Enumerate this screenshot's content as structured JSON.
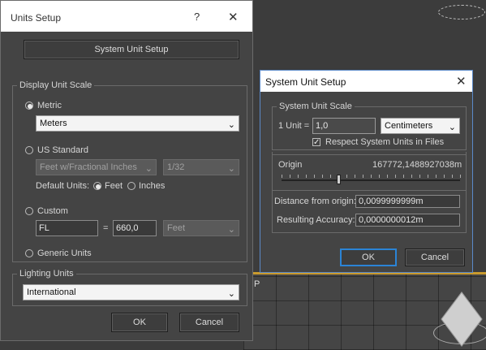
{
  "units_setup": {
    "title": "Units Setup",
    "help_label": "?",
    "close_glyph": "✕",
    "system_unit_setup_button": "System Unit Setup",
    "display_unit_scale": {
      "legend": "Display Unit Scale",
      "metric_label": "Metric",
      "metric_value": "Meters",
      "us_standard_label": "US Standard",
      "us_standard_value": "Feet w/Fractional Inches",
      "fraction_value": "1/32",
      "default_units_label": "Default Units:",
      "feet_label": "Feet",
      "inches_label": "Inches",
      "custom_label": "Custom",
      "custom_name": "FL",
      "equals": "=",
      "custom_value": "660,0",
      "custom_unit": "Feet",
      "generic_label": "Generic Units"
    },
    "lighting_units": {
      "legend": "Lighting Units",
      "value": "International"
    },
    "ok_label": "OK",
    "cancel_label": "Cancel"
  },
  "system_unit_setup": {
    "title": "System Unit Setup",
    "close_glyph": "✕",
    "scale_legend": "System Unit Scale",
    "unit_label": "1 Unit =",
    "unit_value": "1,0",
    "unit_type": "Centimeters",
    "respect_label": "Respect System Units in Files",
    "respect_checked": true,
    "origin_label": "Origin",
    "origin_value": "167772,1488927038m",
    "distance_label": "Distance from origin:",
    "distance_value": "0,0099999999m",
    "accuracy_label": "Resulting Accuracy:",
    "accuracy_value": "0,0000000012m",
    "ok_label": "OK",
    "cancel_label": "Cancel"
  },
  "background": {
    "viewport_letter": "P"
  }
}
